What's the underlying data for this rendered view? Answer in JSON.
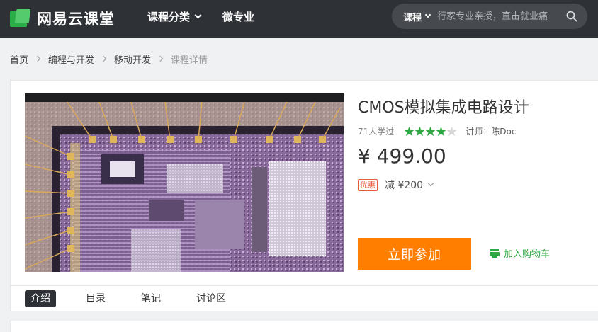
{
  "header": {
    "logo_text": "网易云课堂",
    "nav": [
      {
        "label": "课程分类",
        "has_dropdown": true
      },
      {
        "label": "微专业",
        "has_dropdown": false
      }
    ],
    "search": {
      "category": "课程",
      "placeholder": "行家专业亲授，直击就业痛"
    }
  },
  "breadcrumb": [
    "首页",
    "编程与开发",
    "移动开发",
    "课程详情"
  ],
  "course": {
    "title": "CMOS模拟集成电路设计",
    "learners": "71人学过",
    "rating": 4,
    "rating_max": 5,
    "teacher": "讲师：陈Doc",
    "price": "¥ 499.00",
    "promo_tag": "优惠",
    "promo_text": "减 ¥200",
    "join_label": "立即参加",
    "cart_label": "加入购物车"
  },
  "tabs": [
    {
      "label": "介绍",
      "active": true
    },
    {
      "label": "目录",
      "active": false
    },
    {
      "label": "笔记",
      "active": false
    },
    {
      "label": "讨论区",
      "active": false
    }
  ],
  "colors": {
    "header_bg": "#2e3237",
    "accent_orange": "#ff7e00",
    "star_green": "#2fa744",
    "promo_red": "#e85c3c"
  }
}
